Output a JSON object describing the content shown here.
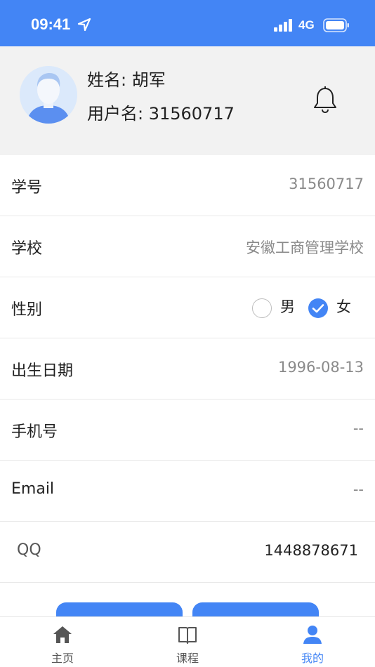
{
  "status_bar": {
    "time": "09:41",
    "network": "4G",
    "background_color": "#4385f5",
    "icons": [
      "location-arrow-icon",
      "signal-bars-icon",
      "battery-icon"
    ]
  },
  "profile": {
    "name_line": "姓名: 胡军",
    "username_line": "用户名: 31560717",
    "avatar_icon": "user-avatar-icon",
    "notification_icon": "bell-icon"
  },
  "fields": {
    "student_id": {
      "label": "学号",
      "value": "31560717"
    },
    "school": {
      "label": "学校",
      "value": "安徽工商管理学校"
    },
    "gender": {
      "label": "性别",
      "options": [
        "男",
        "女"
      ],
      "selected": "女"
    },
    "birth_date": {
      "label": "出生日期",
      "value": "1996-08-13"
    },
    "phone": {
      "label": "手机号",
      "value": "--"
    },
    "email": {
      "label": "Email",
      "value": "--"
    },
    "qq": {
      "label": "QQ",
      "value": "1448878671"
    }
  },
  "tab_bar": {
    "tabs": [
      {
        "label": "主页",
        "icon": "home-icon",
        "active": false
      },
      {
        "label": "课程",
        "icon": "book-icon",
        "active": false
      },
      {
        "label": "我的",
        "icon": "person-icon",
        "active": true
      }
    ],
    "active_color": "#4385f5"
  }
}
